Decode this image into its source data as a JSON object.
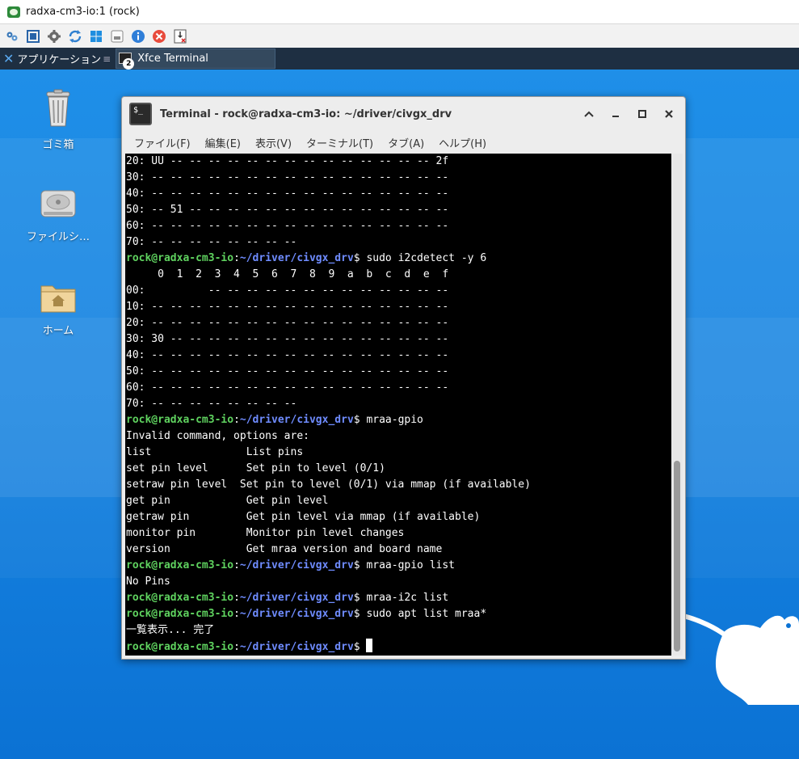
{
  "vnc": {
    "title": "radxa-cm3-io:1 (rock)",
    "toolbar": [
      {
        "name": "options-icon"
      },
      {
        "name": "fullscreen-icon"
      },
      {
        "name": "settings-gear-icon"
      },
      {
        "name": "refresh-icon"
      },
      {
        "name": "windows-key-icon"
      },
      {
        "name": "ctrl-alt-del-icon"
      },
      {
        "name": "info-icon"
      },
      {
        "name": "disconnect-icon"
      },
      {
        "name": "file-transfer-icon"
      }
    ]
  },
  "panel": {
    "apps_menu_label": "アプリケーション",
    "apps_separator": "≡",
    "task_label": "Xfce Terminal",
    "task_badge": "2"
  },
  "desktop": {
    "icons": [
      {
        "label": "ゴミ箱",
        "icon": "trash-icon"
      },
      {
        "label": "ファイルシ…",
        "icon": "drive-icon"
      },
      {
        "label": "ホーム",
        "icon": "home-folder-icon"
      }
    ]
  },
  "terminal": {
    "title": "Terminal - rock@radxa-cm3-io: ~/driver/civgx_drv",
    "icon_text": "$_",
    "menus": [
      "ファイル(F)",
      "編集(E)",
      "表示(V)",
      "ターミナル(T)",
      "タブ(A)",
      "ヘルプ(H)"
    ],
    "prompt_user": "rock@radxa-cm3-io",
    "prompt_colon": ":",
    "prompt_path": "~/driver/civgx_drv",
    "prompt_dollar": "$ ",
    "lines": [
      {
        "type": "out",
        "text": "20: UU -- -- -- -- -- -- -- -- -- -- -- -- -- -- 2f"
      },
      {
        "type": "out",
        "text": "30: -- -- -- -- -- -- -- -- -- -- -- -- -- -- -- --"
      },
      {
        "type": "out",
        "text": "40: -- -- -- -- -- -- -- -- -- -- -- -- -- -- -- --"
      },
      {
        "type": "out",
        "text": "50: -- 51 -- -- -- -- -- -- -- -- -- -- -- -- -- --"
      },
      {
        "type": "out",
        "text": "60: -- -- -- -- -- -- -- -- -- -- -- -- -- -- -- --"
      },
      {
        "type": "out",
        "text": "70: -- -- -- -- -- -- -- --"
      },
      {
        "type": "cmd",
        "text": "sudo i2cdetect -y 6"
      },
      {
        "type": "out",
        "text": "     0  1  2  3  4  5  6  7  8  9  a  b  c  d  e  f"
      },
      {
        "type": "out",
        "text": "00:          -- -- -- -- -- -- -- -- -- -- -- -- --"
      },
      {
        "type": "out",
        "text": "10: -- -- -- -- -- -- -- -- -- -- -- -- -- -- -- --"
      },
      {
        "type": "out",
        "text": "20: -- -- -- -- -- -- -- -- -- -- -- -- -- -- -- --"
      },
      {
        "type": "out",
        "text": "30: 30 -- -- -- -- -- -- -- -- -- -- -- -- -- -- --"
      },
      {
        "type": "out",
        "text": "40: -- -- -- -- -- -- -- -- -- -- -- -- -- -- -- --"
      },
      {
        "type": "out",
        "text": "50: -- -- -- -- -- -- -- -- -- -- -- -- -- -- -- --"
      },
      {
        "type": "out",
        "text": "60: -- -- -- -- -- -- -- -- -- -- -- -- -- -- -- --"
      },
      {
        "type": "out",
        "text": "70: -- -- -- -- -- -- -- --"
      },
      {
        "type": "cmd",
        "text": "mraa-gpio"
      },
      {
        "type": "out",
        "text": "Invalid command, options are:"
      },
      {
        "type": "out",
        "text": "list               List pins"
      },
      {
        "type": "out",
        "text": "set pin level      Set pin to level (0/1)"
      },
      {
        "type": "out",
        "text": "setraw pin level  Set pin to level (0/1) via mmap (if available)"
      },
      {
        "type": "out",
        "text": "get pin            Get pin level"
      },
      {
        "type": "out",
        "text": "getraw pin         Get pin level via mmap (if available)"
      },
      {
        "type": "out",
        "text": "monitor pin        Monitor pin level changes"
      },
      {
        "type": "out",
        "text": "version            Get mraa version and board name"
      },
      {
        "type": "cmd",
        "text": "mraa-gpio list"
      },
      {
        "type": "out",
        "text": "No Pins"
      },
      {
        "type": "cmd",
        "text": "mraa-i2c list"
      },
      {
        "type": "cmd",
        "text": "sudo apt list mraa*"
      },
      {
        "type": "out",
        "text": "一覧表示... 完了"
      },
      {
        "type": "cmd",
        "text": ""
      }
    ]
  },
  "colors": {
    "prompt_user": "#5fd25f",
    "prompt_path": "#6f8cff",
    "desktop": "#1783e0",
    "panel": "#1e2f42"
  }
}
